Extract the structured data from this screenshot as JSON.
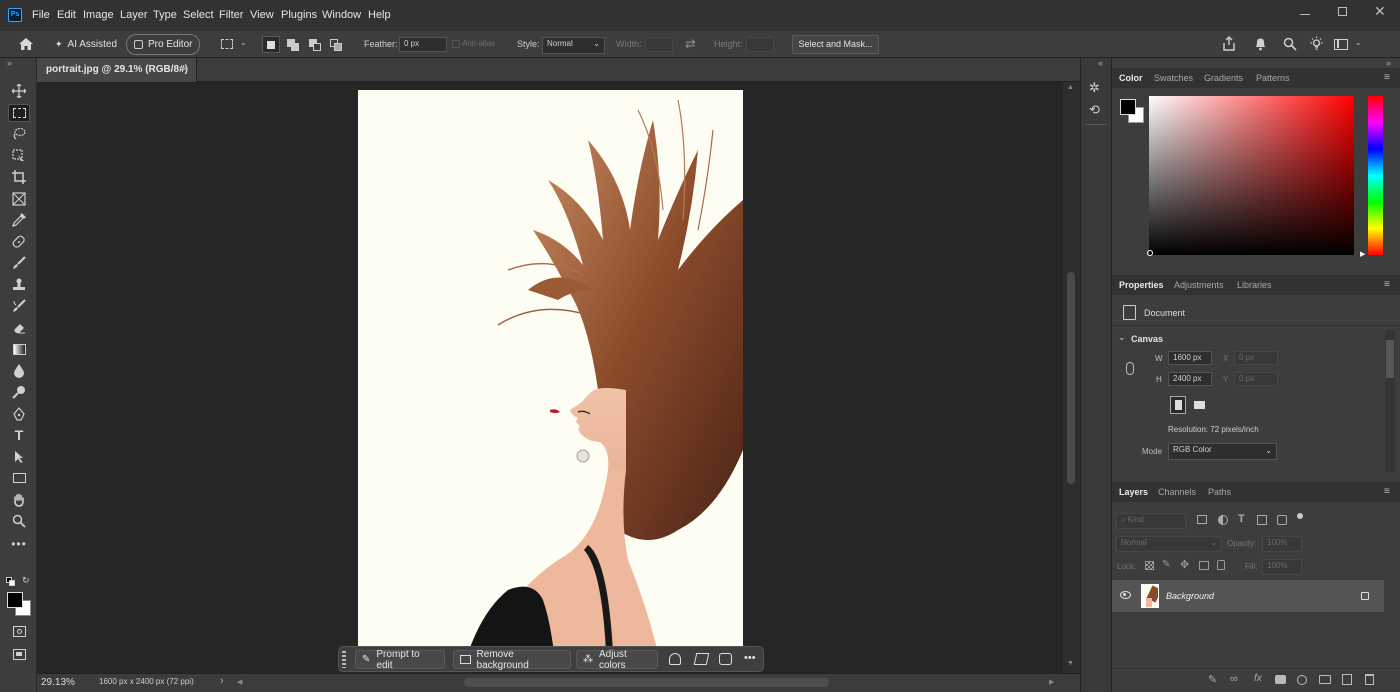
{
  "app": {
    "logo_text": "Ps"
  },
  "menu": [
    "File",
    "Edit",
    "Image",
    "Layer",
    "Type",
    "Select",
    "Filter",
    "View",
    "Plugins",
    "Window",
    "Help"
  ],
  "options": {
    "ai_assisted": "AI Assisted",
    "pro_editor": "Pro Editor",
    "feather_label": "Feather:",
    "feather_value": "0 px",
    "antialias": "Anti-alias",
    "style_label": "Style:",
    "style_value": "Normal",
    "width_label": "Width:",
    "height_label": "Height:",
    "select_mask": "Select and Mask..."
  },
  "document": {
    "tab_title": "portrait.jpg @ 29.1% (RGB/8#)",
    "close": "×"
  },
  "status": {
    "zoom": "29.13%",
    "info": "1600 px x 2400 px (72 ppi)",
    "arrow": "›"
  },
  "context_bar": {
    "prompt": "Prompt to edit",
    "remove_bg": "Remove background",
    "adjust": "Adjust colors",
    "more": "•••"
  },
  "color_panel": {
    "tabs": [
      "Color",
      "Swatches",
      "Gradients",
      "Patterns"
    ],
    "active": 0
  },
  "properties_panel": {
    "tabs": [
      "Properties",
      "Adjustments",
      "Libraries"
    ],
    "doc_label": "Document",
    "section": "Canvas",
    "w_label": "W",
    "w_value": "1600 px",
    "h_label": "H",
    "h_value": "2400 px",
    "x_label": "X",
    "x_value": "0 px",
    "y_label": "Y",
    "y_value": "0 px",
    "resolution": "Resolution: 72 pixels/inch",
    "mode_label": "Mode",
    "mode_value": "RGB Color"
  },
  "layers_panel": {
    "tabs": [
      "Layers",
      "Channels",
      "Paths"
    ],
    "kind": "Kind",
    "blend": "Normal",
    "opacity_label": "Opacity:",
    "opacity_value": "100%",
    "lock_label": "Lock:",
    "fill_label": "Fill:",
    "fill_value": "100%",
    "layer_name": "Background"
  },
  "colors": {
    "accent": "#d4d4d4",
    "panel": "#3d3d3d",
    "canvas_bg": "#fefdf4",
    "hair": "#8a4a2a"
  }
}
